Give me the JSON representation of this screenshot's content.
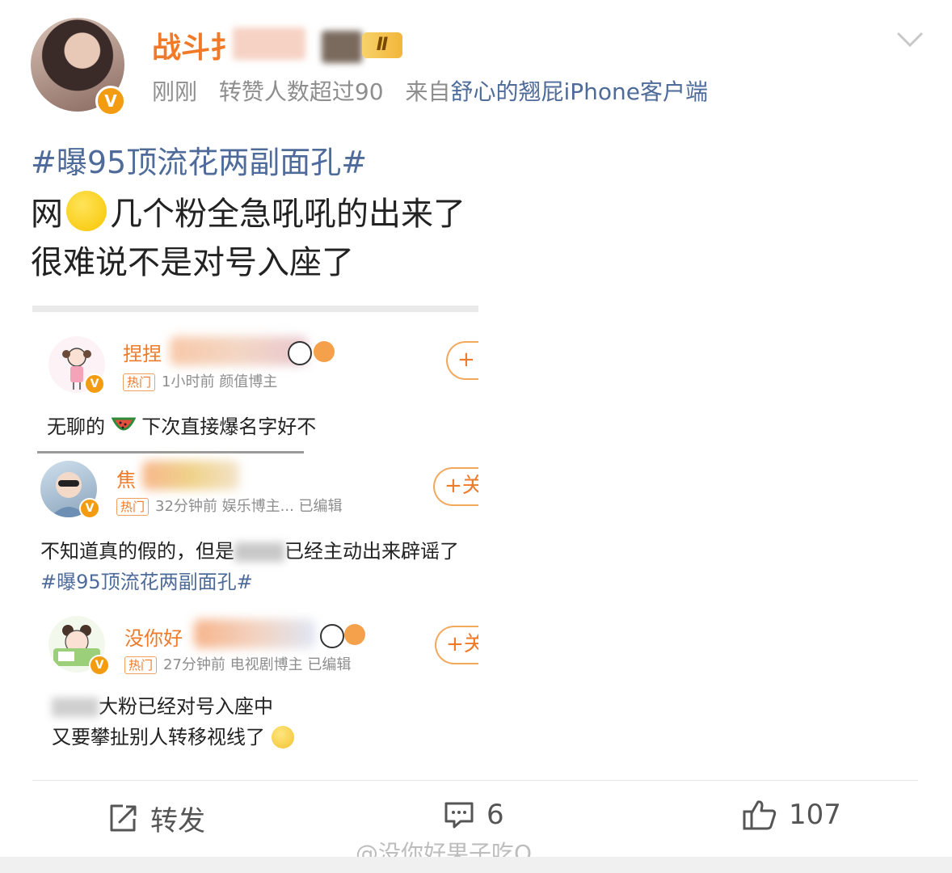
{
  "post": {
    "username": "战斗扌",
    "vip_label": "Ⅱ",
    "time": "刚刚",
    "reposts_note": "转赞人数超过90",
    "source_prefix": "来自",
    "source": "舒心的翘屁iPhone客户端",
    "hashtag": "#曝95顶流花两副面孔#",
    "line1_a": "网",
    "line1_b": "几个粉全急吼吼的出来了",
    "line2": "很难说不是对号入座了",
    "verified_mark": "V"
  },
  "embedded": {
    "comments": [
      {
        "name": "捏捏",
        "hot": "热门",
        "meta": "1小时前  颜值博主",
        "text_a": "无聊的",
        "text_b": " 下次直接爆名字好不",
        "follow": "+"
      },
      {
        "name": "焦",
        "hot": "热门",
        "meta": "32分钟前  娱乐博主...  已编辑",
        "text_a": "不知道真的假的，但是",
        "text_b": "已经主动出来辟谣了",
        "hashtag": "#曝95顶流花两副面孔#",
        "follow": "+关"
      },
      {
        "name": "没你好",
        "hot": "热门",
        "meta": "27分钟前  电视剧博主  已编辑",
        "text_a": "大粉已经对号入座中",
        "text_b": "又要攀扯别人转移视线了",
        "follow": "+关"
      }
    ]
  },
  "actions": {
    "repost_label": "转发",
    "comment_count": "6",
    "like_count": "107"
  },
  "watermark": "@没你好果子吃O",
  "colors": {
    "accent_orange": "#f07a28",
    "link_blue": "#4e6b9a",
    "meta_gray": "#8e8e8e"
  }
}
